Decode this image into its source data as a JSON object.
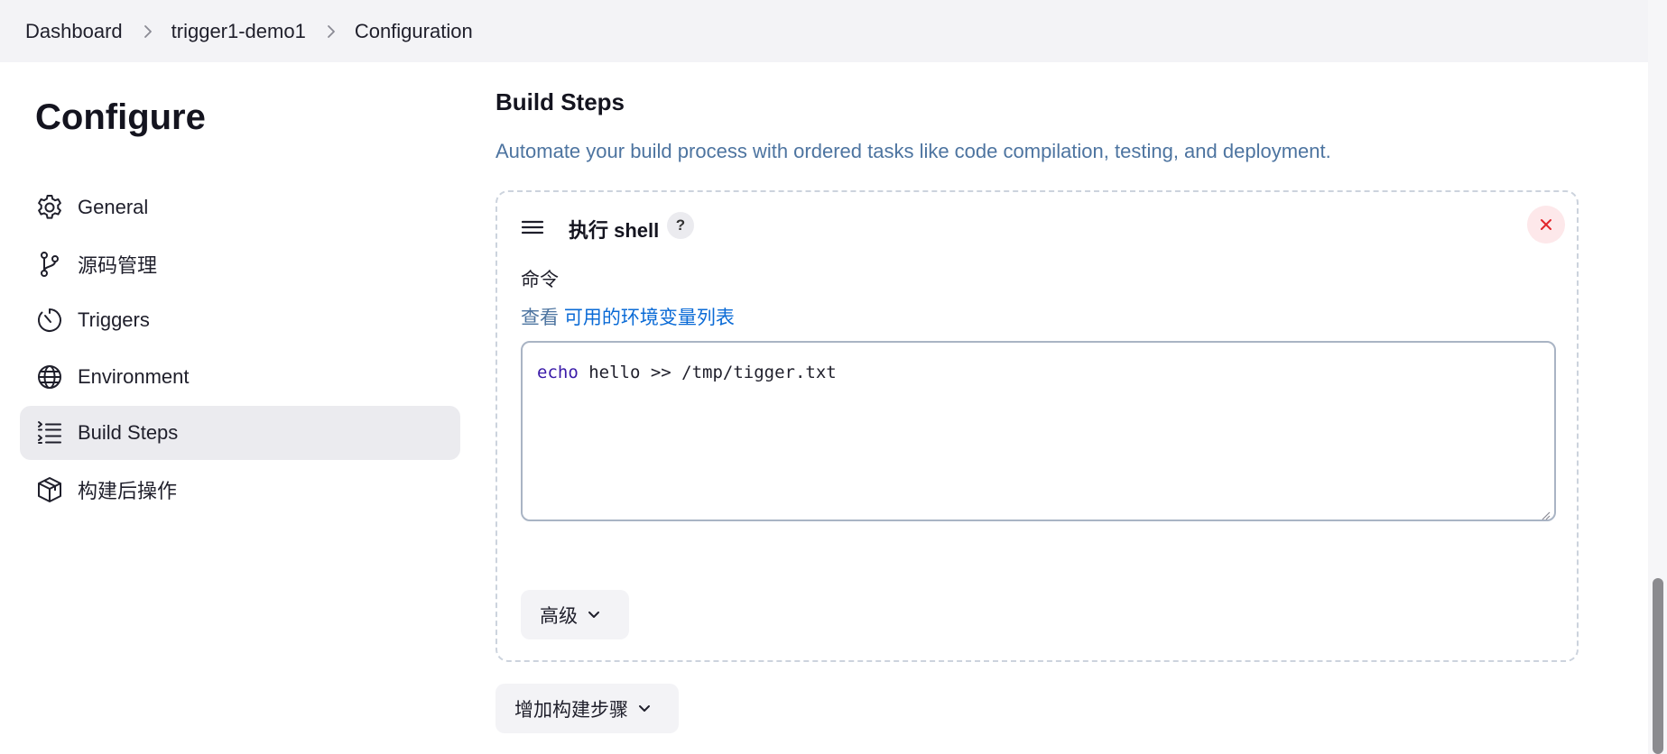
{
  "breadcrumb": {
    "items": [
      "Dashboard",
      "trigger1-demo1",
      "Configuration"
    ]
  },
  "sidebar": {
    "title": "Configure",
    "items": [
      {
        "label": "General",
        "icon": "gear-icon"
      },
      {
        "label": "源码管理",
        "icon": "source-branch-icon"
      },
      {
        "label": "Triggers",
        "icon": "timer-icon"
      },
      {
        "label": "Environment",
        "icon": "globe-icon"
      },
      {
        "label": "Build Steps",
        "icon": "list-icon",
        "active": true
      },
      {
        "label": "构建后操作",
        "icon": "package-icon"
      }
    ]
  },
  "main": {
    "section_title": "Build Steps",
    "section_description": "Automate your build process with ordered tasks like code compilation, testing, and deployment.",
    "step": {
      "title": "执行 shell",
      "help": "?",
      "command_label": "命令",
      "env_prefix": "查看",
      "env_link": "可用的环境变量列表",
      "command_keyword": "echo",
      "command_rest": " hello >> /tmp/tigger.txt",
      "advanced_label": "高级"
    },
    "add_step_label": "增加构建步骤"
  },
  "colors": {
    "accent_link": "#0b6bd6",
    "description": "#4d74a0",
    "delete": "#e2252b",
    "active_nav": "#ebebef"
  }
}
